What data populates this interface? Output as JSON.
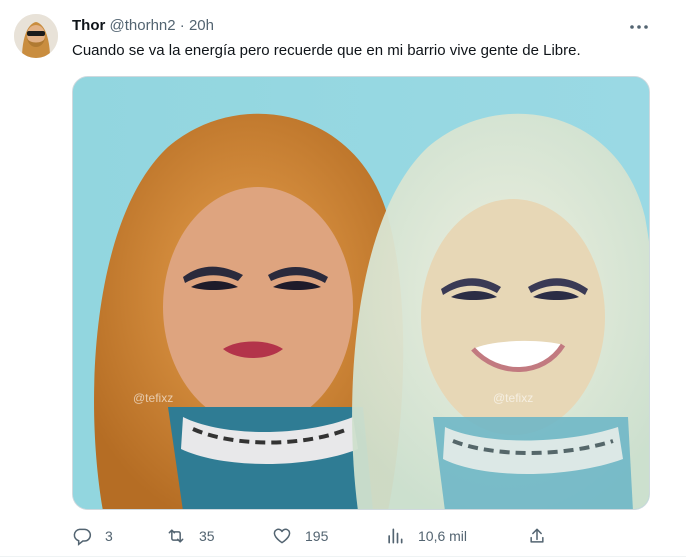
{
  "tweet": {
    "author_name": "Thor",
    "author_handle": "@thorhn2",
    "separator": "·",
    "time": "20h",
    "text": "Cuando se va la energía pero recuerde que en mi barrio vive gente de Libre.",
    "image_description_icon": "meme-image",
    "watermark_left": "@tefixz",
    "watermark_right": "@tefixz"
  },
  "actions": {
    "replies": "3",
    "retweets": "35",
    "likes": "195",
    "views": "10,6 mil"
  },
  "icons": {
    "more": "more-horizontal-icon",
    "reply": "reply-icon",
    "retweet": "retweet-icon",
    "like": "heart-icon",
    "views": "views-chart-icon",
    "share": "share-icon"
  },
  "colors": {
    "text_primary": "#0f1419",
    "text_secondary": "#536471",
    "media_bg": "#8fd3dd"
  }
}
